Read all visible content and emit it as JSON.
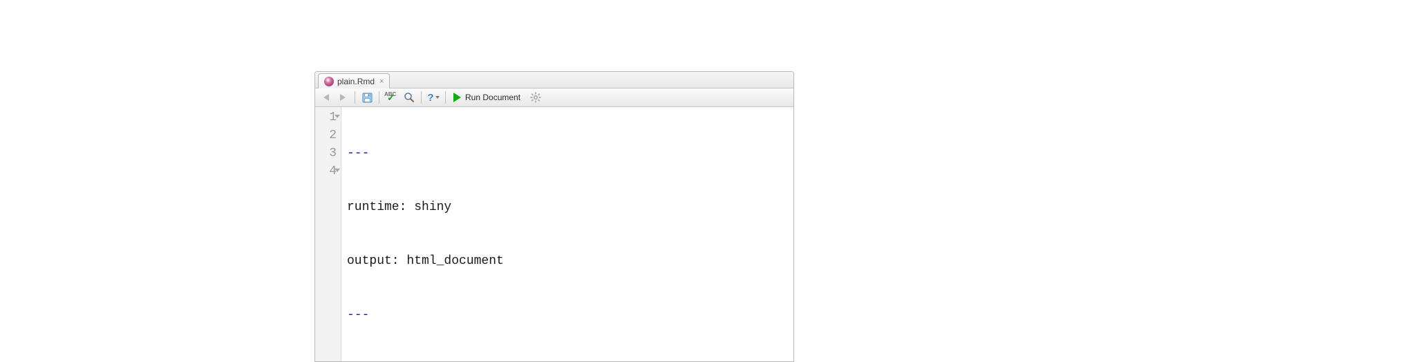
{
  "tab": {
    "filename": "plain.Rmd",
    "close_glyph": "×"
  },
  "toolbar": {
    "run_label": "Run Document",
    "help_glyph": "?"
  },
  "gutter": {
    "l1": "1",
    "l2": "2",
    "l3": "3",
    "l4": "4"
  },
  "code": {
    "l1": "---",
    "l2": "runtime: shiny",
    "l3": "output: html_document",
    "l4": "---"
  }
}
